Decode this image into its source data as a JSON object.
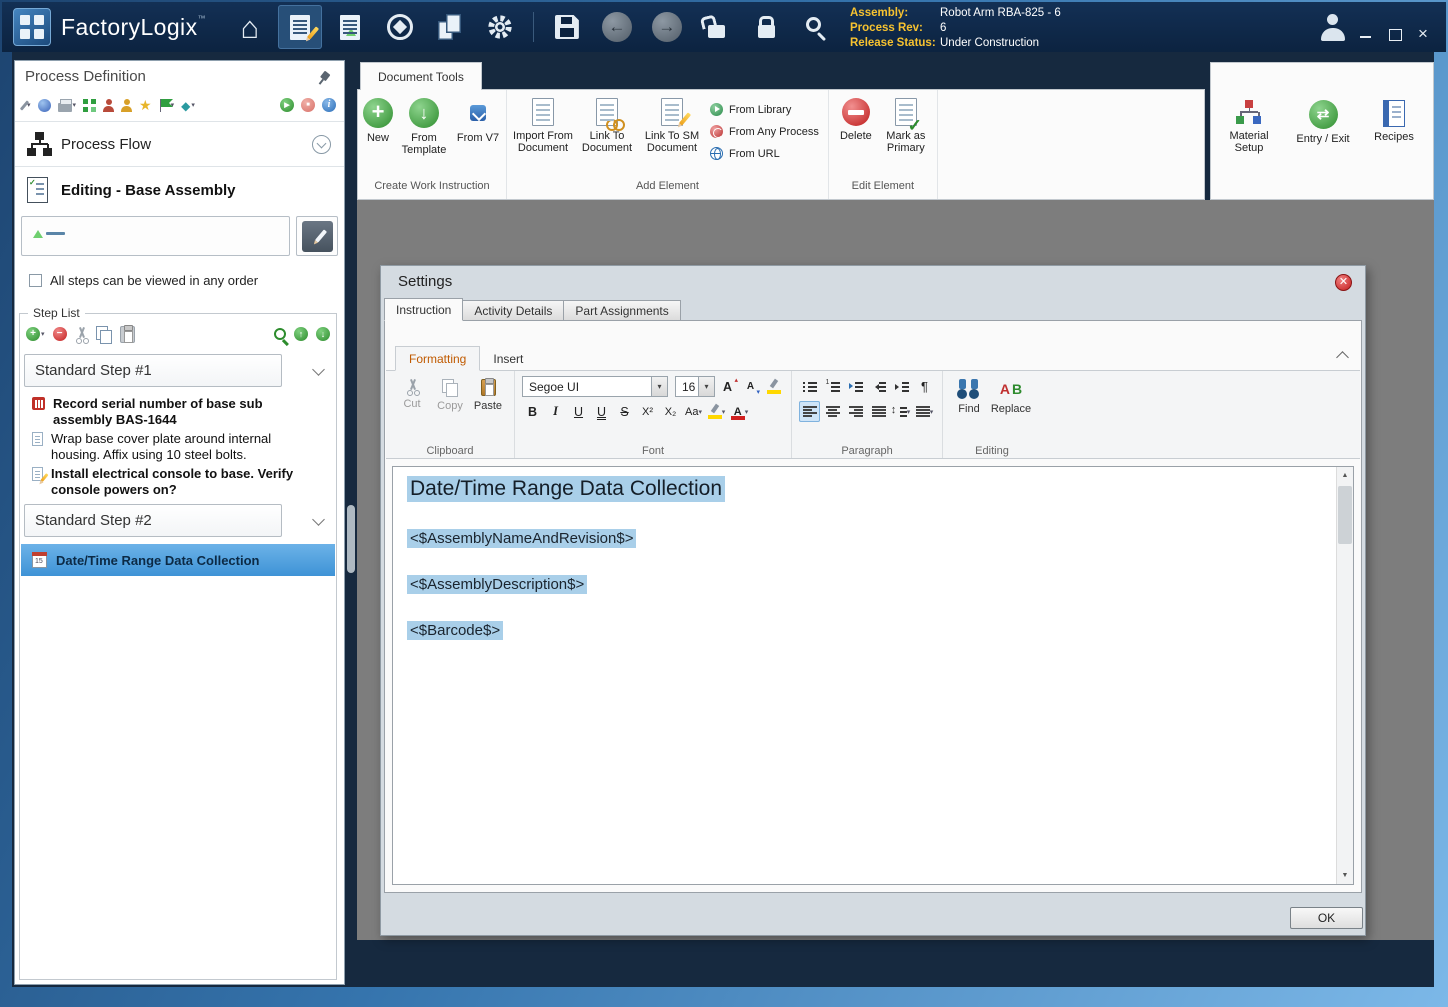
{
  "titlebar": {
    "app_name": "FactoryLogix",
    "trademark": "™",
    "assembly_label": "Assembly:",
    "assembly_value": "Robot Arm RBA-825 - 6",
    "process_rev_label": "Process Rev:",
    "process_rev_value": "6",
    "release_status_label": "Release Status:",
    "release_status_value": "Under Construction"
  },
  "sidebar": {
    "title": "Process Definition",
    "process_flow_label": "Process Flow",
    "editing_label": "Editing - Base Assembly",
    "order_checkbox_label": "All steps can be viewed in any order",
    "step_list_title": "Step List",
    "step1_label": "Standard Step #1",
    "step1_items": [
      "Record serial number of base sub assembly BAS-1644",
      "Wrap base cover plate around internal housing. Affix using 10 steel bolts.",
      "Install electrical console to base. Verify console powers on?"
    ],
    "step2_label": "Standard Step #2",
    "step2_items": [
      "Date/Time Range Data Collection"
    ]
  },
  "ribbon": {
    "context_tab": "Document Tools",
    "group1_label": "Create Work Instruction",
    "btn_new": "New",
    "btn_from_template": "From Template",
    "btn_from_v7": "From V7",
    "group2_label": "Add Element",
    "btn_import_from_document": "Import From Document",
    "btn_link_to_document": "Link To Document",
    "btn_link_to_sm_document": "Link To SM Document",
    "btn_from_library": "From Library",
    "btn_from_any_process": "From Any Process",
    "btn_from_url": "From URL",
    "group3_label": "Edit Element",
    "btn_delete": "Delete",
    "btn_mark_as_primary": "Mark as Primary",
    "btn_material_setup": "Material Setup",
    "btn_entry_exit": "Entry / Exit",
    "btn_recipes": "Recipes"
  },
  "dialog": {
    "title": "Settings",
    "tab_instruction": "Instruction",
    "tab_activity_details": "Activity Details",
    "tab_part_assignments": "Part Assignments",
    "editor": {
      "tab_formatting": "Formatting",
      "tab_insert": "Insert",
      "clipboard_label": "Clipboard",
      "cut": "Cut",
      "copy": "Copy",
      "paste": "Paste",
      "font_label": "Font",
      "font_family": "Segoe UI",
      "font_size": "16",
      "paragraph_label": "Paragraph",
      "editing_label": "Editing",
      "find": "Find",
      "replace": "Replace"
    },
    "document": {
      "heading": "Date/Time Range Data Collection",
      "line1": "<$AssemblyNameAndRevision$>",
      "line2": "<$AssemblyDescription$>",
      "line3": "<$Barcode$>"
    },
    "ok_label": "OK"
  }
}
